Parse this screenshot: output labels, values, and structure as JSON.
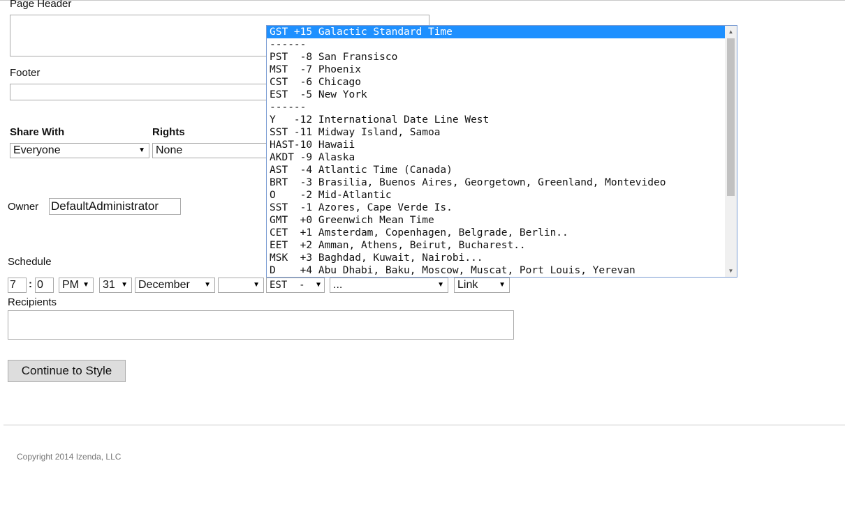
{
  "page_header": {
    "label": "Page Header"
  },
  "footer": {
    "label": "Footer"
  },
  "share": {
    "share_with_label": "Share With",
    "share_with_value": "Everyone",
    "rights_label": "Rights",
    "rights_value": "None"
  },
  "owner": {
    "label": "Owner",
    "value": "DefaultAdministrator"
  },
  "schedule": {
    "label": "Schedule",
    "hour": "7",
    "separator": ":",
    "minute": "0",
    "ampm": "PM",
    "day": "31",
    "month": "December",
    "year": "",
    "timezone": "EST  -",
    "recurrence": "...",
    "delivery": "Link"
  },
  "recipients": {
    "label": "Recipients",
    "value": ""
  },
  "continue_button": "Continue to Style",
  "timezone_dropdown": {
    "options": [
      "GST +15 Galactic Standard Time",
      "------",
      "PST  -8 San Fransisco",
      "MST  -7 Phoenix",
      "CST  -6 Chicago",
      "EST  -5 New York",
      "------",
      "Y   -12 International Date Line West",
      "SST -11 Midway Island, Samoa",
      "HAST-10 Hawaii",
      "AKDT -9 Alaska",
      "AST  -4 Atlantic Time (Canada)",
      "BRT  -3 Brasilia, Buenos Aires, Georgetown, Greenland, Montevideo",
      "O    -2 Mid-Atlantic",
      "SST  -1 Azores, Cape Verde Is.",
      "GMT  +0 Greenwich Mean Time",
      "CET  +1 Amsterdam, Copenhagen, Belgrade, Berlin..",
      "EET  +2 Amman, Athens, Beirut, Bucharest..",
      "MSK  +3 Baghdad, Kuwait, Nairobi...",
      "D    +4 Abu Dhabi, Baku, Moscow, Muscat, Port Louis, Yerevan"
    ],
    "selected_index": 0
  },
  "copyright": "Copyright 2014 Izenda, LLC",
  "icons": {
    "dropdown_arrow": "chevron-down-icon",
    "scroll_up": "scroll-up-icon",
    "scroll_down": "scroll-down-icon"
  },
  "colors": {
    "selection": "#1e90ff",
    "button_bg": "#dddddd"
  }
}
